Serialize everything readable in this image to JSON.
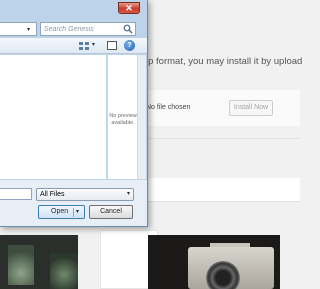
{
  "background": {
    "upload_text": "ip format, you may install it by upload",
    "no_file_text": "No file chosen",
    "install_button": "Install Now"
  },
  "dialog": {
    "close_icon": "close-icon",
    "search": {
      "placeholder": "Search Genesis"
    },
    "preview_text": "No preview available.",
    "file_type_filter": "All Files",
    "open_label": "Open",
    "cancel_label": "Cancel",
    "accent_color": "#3c7fb1",
    "close_color": "#c7402f"
  }
}
